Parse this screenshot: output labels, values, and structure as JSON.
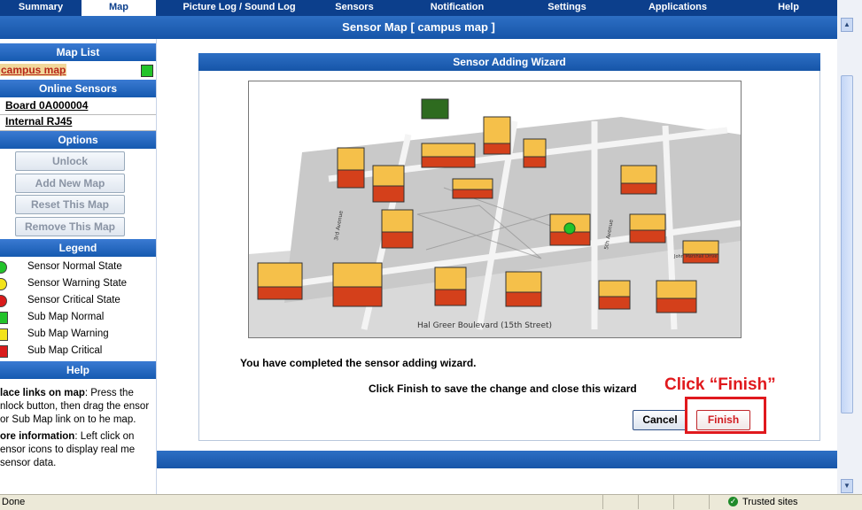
{
  "nav": {
    "tabs": [
      "Summary",
      "Map",
      "Picture Log / Sound Log",
      "Sensors",
      "Notification",
      "Settings",
      "Applications",
      "Help"
    ],
    "active": "Map"
  },
  "page_title": "Sensor Map [ campus map ]",
  "left": {
    "map_list_header": "Map List",
    "map_item": "campus map",
    "online_sensors_header": "Online Sensors",
    "sensors": [
      "Board 0A000004",
      "Internal RJ45"
    ],
    "options_header": "Options",
    "buttons": {
      "unlock": "Unlock",
      "add_new_map": "Add New Map",
      "reset_map": "Reset This Map",
      "remove_map": "Remove This Map"
    },
    "legend_header": "Legend",
    "legend": [
      {
        "label": "Sensor Normal State",
        "color": "#22c32a",
        "shape": "dot"
      },
      {
        "label": "Sensor Warning State",
        "color": "#f3e31a",
        "shape": "dot"
      },
      {
        "label": "Sensor Critical State",
        "color": "#d91b1b",
        "shape": "dot"
      },
      {
        "label": "Sub Map Normal",
        "color": "#22c32a",
        "shape": "square"
      },
      {
        "label": "Sub Map Warning",
        "color": "#f3e31a",
        "shape": "square"
      },
      {
        "label": "Sub Map Critical",
        "color": "#d91b1b",
        "shape": "square"
      }
    ],
    "help_header": "Help",
    "help_p1_bold": "lace links on map",
    "help_p1_rest": ": Press the nlock button, then drag the ensor or Sub Map link on to he map.",
    "help_p2_bold": "ore information",
    "help_p2_rest": ": Left click on ensor icons to display real me sensor data."
  },
  "wizard": {
    "title": "Sensor Adding Wizard",
    "map_caption": "Hal Greer Boulevard (15th Street)",
    "street_label_1": "3rd Avenue",
    "street_label_2": "5th Avenue",
    "corner_label": "John Marshall Drive",
    "complete_message": "You have completed the sensor adding wizard.",
    "finish_instruction": "Click Finish to save the change and close this wizard",
    "callout": "Click “Finish”",
    "cancel_label": "Cancel",
    "finish_label": "Finish"
  },
  "status": {
    "left_text": "Done",
    "zone": "Trusted sites"
  }
}
